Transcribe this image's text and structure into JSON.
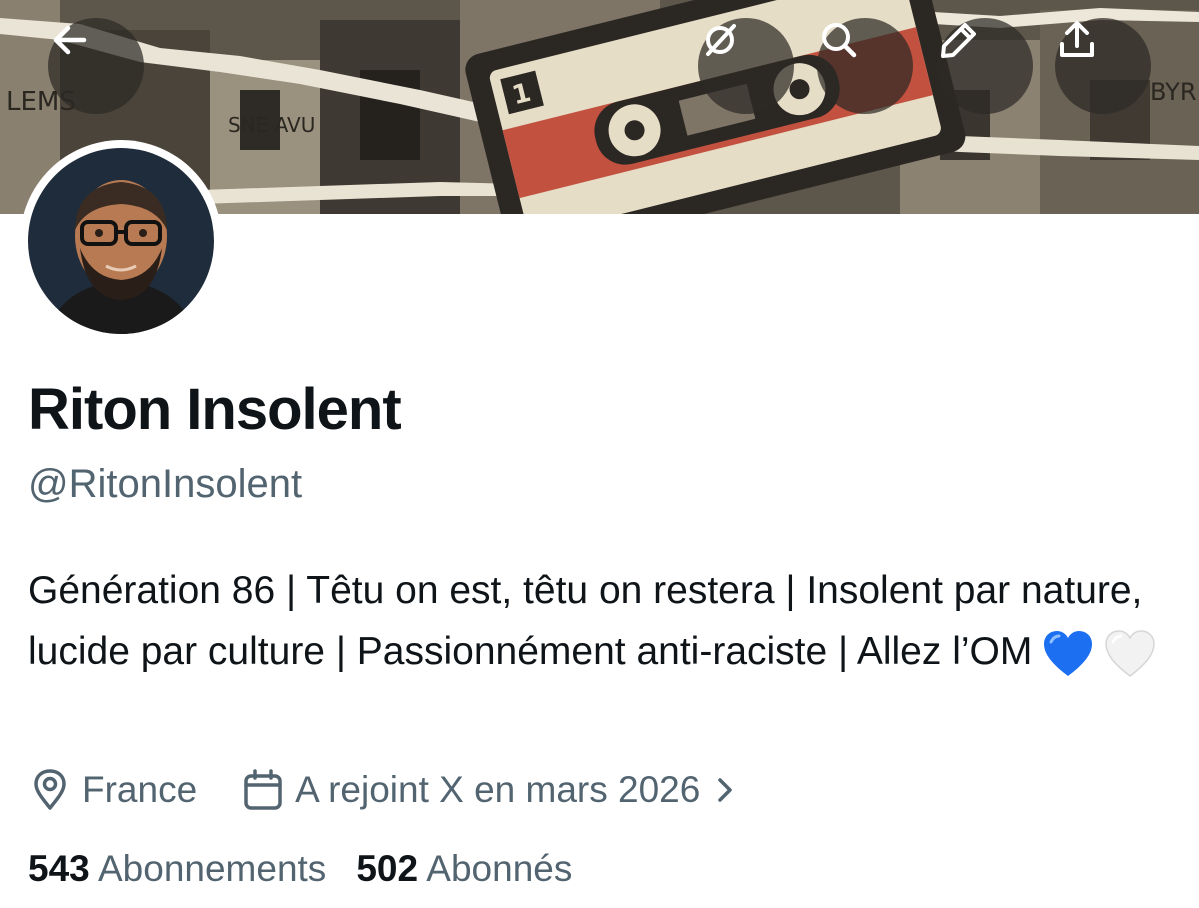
{
  "header": {
    "back_icon": "arrow-left-icon",
    "grok_icon": "grok-slash-icon",
    "search_icon": "search-icon",
    "edit_icon": "pencil-icon",
    "share_icon": "share-upload-icon"
  },
  "banner": {
    "cassette_label": "1"
  },
  "profile": {
    "display_name": "Riton Insolent",
    "handle": "@RitonInsolent",
    "bio": "Génération 86 | Têtu on est, têtu on restera | Insolent par nature, lucide par culture | Passionnément anti-raciste | Allez l’OM",
    "bio_emojis": [
      "blue-heart-icon",
      "white-heart-icon"
    ],
    "location": "France",
    "location_icon": "map-pin-icon",
    "joined": "A rejoint X en mars 2026",
    "joined_icon": "calendar-icon"
  },
  "stats": {
    "following_count": "543",
    "following_label": "Abonnements",
    "followers_count": "502",
    "followers_label": "Abonnés"
  },
  "colors": {
    "text_primary": "#0f1419",
    "text_secondary": "#536471",
    "header_button_bg": "#2d2a26",
    "heart_blue": "#1d6ff2",
    "heart_white": "#f2f2f2"
  }
}
